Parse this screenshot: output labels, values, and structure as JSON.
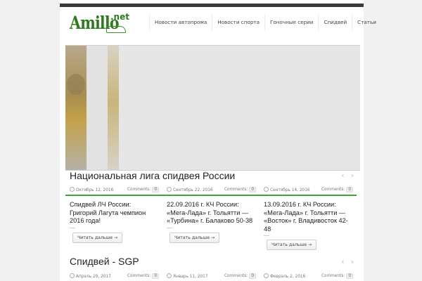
{
  "logo": {
    "text": "Amillo",
    "net": ".net"
  },
  "nav": [
    "Новости автопрома",
    "Новости спорта",
    "Гоночные серии",
    "Спидвей",
    "Статьи"
  ],
  "sections": [
    {
      "title": "Национальная лига спидвея России",
      "arrows": [
        "‹",
        "›"
      ],
      "posts": [
        {
          "date": "Октябрь 12, 2016",
          "comments_label": "Comments:",
          "comments": "0",
          "title": "Спидвей ЛЧ России: Григорий Лагута чемпион 2016 года!",
          "read_more": "Читать дальше →"
        },
        {
          "date": "Сентябрь 22, 2016",
          "comments_label": "Comments:",
          "comments": "0",
          "title": "22.09.2016 г. КЧ России: «Мега-Лада» г. Тольятти — «Турбина» г. Балаково 50-38",
          "read_more": "Читать дальше →"
        },
        {
          "date": "Сентябрь 14, 2016",
          "comments_label": "Comments:",
          "comments": "0",
          "title": "13.09.2016 г. КЧ России: «Мега-Лада» г. Тольятти — «Восток» г. Владивосток 42-48",
          "read_more": "Читать дальше →"
        }
      ]
    },
    {
      "title": "Спидвей - SGP",
      "arrows": [
        "‹",
        "›"
      ],
      "posts": [
        {
          "date": "Апрель 29, 2017",
          "comments_label": "Comments:",
          "comments": "0"
        },
        {
          "date": "Январь 11, 2017",
          "comments_label": "Comments:",
          "comments": "0"
        },
        {
          "date": "Февраль 2, 2016",
          "comments_label": "Comments:",
          "comments": "0"
        }
      ]
    }
  ],
  "colors": {
    "accent": "#3aa73a",
    "topbar": "#3a3a3a"
  }
}
